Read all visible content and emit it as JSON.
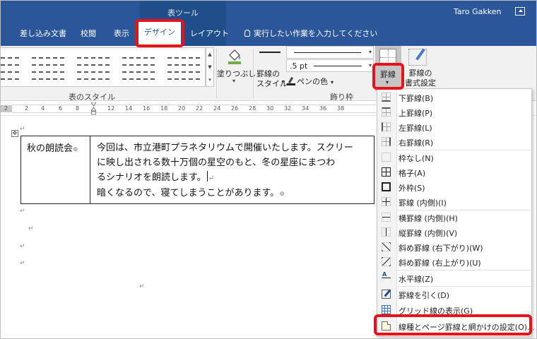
{
  "titlebar": {
    "tool_group": "表ツール",
    "user": "Taro Gakken",
    "tabs": [
      "差し込み文書",
      "校閲",
      "表示"
    ],
    "active_tab": "デザイン",
    "layout_tab": "レイアウト",
    "tell_me": "実行したい作業を入力してください"
  },
  "ribbon": {
    "table_styles_label": "表のスタイル",
    "shading_label": "塗りつぶし",
    "border_styles_label": "罫線の\nスタイル",
    "pen_weight": ".5 pt",
    "pen_color": "ペンの色",
    "borders_group_label": "飾り枠",
    "borders_button": "罫線",
    "border_painter_label": "罫線の\n書式設定"
  },
  "ruler": {
    "numbers": [
      "2",
      "2",
      "4",
      "6",
      "8",
      "12",
      "14",
      "16",
      "18",
      "20",
      "22",
      "24",
      "26",
      "28",
      "30",
      "32",
      "34",
      "36",
      "38"
    ]
  },
  "document": {
    "cell1": "秋の朗読会",
    "cell2_lines": [
      "今回は、市立港町プラネタリウムで開催いたします。スクリー",
      "に映し出される数十万個の星空のもと、冬の星座にまつわ",
      "るシナリオを朗読します。",
      "暗くなるので、寝てしまうことがあります。"
    ],
    "mark": "↵"
  },
  "borders_menu": {
    "items": [
      {
        "label": "下罫線(B)",
        "icon": "border-bottom-icon"
      },
      {
        "label": "上罫線(P)",
        "icon": "border-top-icon"
      },
      {
        "label": "左罫線(L)",
        "icon": "border-left-icon"
      },
      {
        "label": "右罫線(R)",
        "icon": "border-right-icon"
      },
      {
        "label": "枠なし(N)",
        "icon": "no-border-icon"
      },
      {
        "label": "格子(A)",
        "icon": "all-borders-icon"
      },
      {
        "label": "外枠(S)",
        "icon": "outside-borders-icon"
      },
      {
        "label": "罫線 (内側)(I)",
        "icon": "inside-borders-icon"
      },
      {
        "label": "横罫線 (内側)(H)",
        "icon": "inside-horizontal-border-icon"
      },
      {
        "label": "縦罫線 (内側)(V)",
        "icon": "inside-vertical-border-icon"
      },
      {
        "label": "斜め罫線 (右下がり)(W)",
        "icon": "diagonal-down-border-icon"
      },
      {
        "label": "斜め罫線 (右上がり)(U)",
        "icon": "diagonal-up-border-icon"
      },
      {
        "label": "水平線(Z)",
        "icon": "horizontal-line-icon"
      },
      {
        "label": "罫線を引く(D)",
        "icon": "draw-table-icon"
      },
      {
        "label": "グリッド線の表示(G)",
        "icon": "view-gridlines-icon"
      },
      {
        "label": "線種とページ罫線と網かけの設定(O)...",
        "icon": "borders-and-shading-icon"
      }
    ]
  },
  "colors": {
    "title_bar": "#2b579a",
    "highlight": "#e8121c"
  }
}
